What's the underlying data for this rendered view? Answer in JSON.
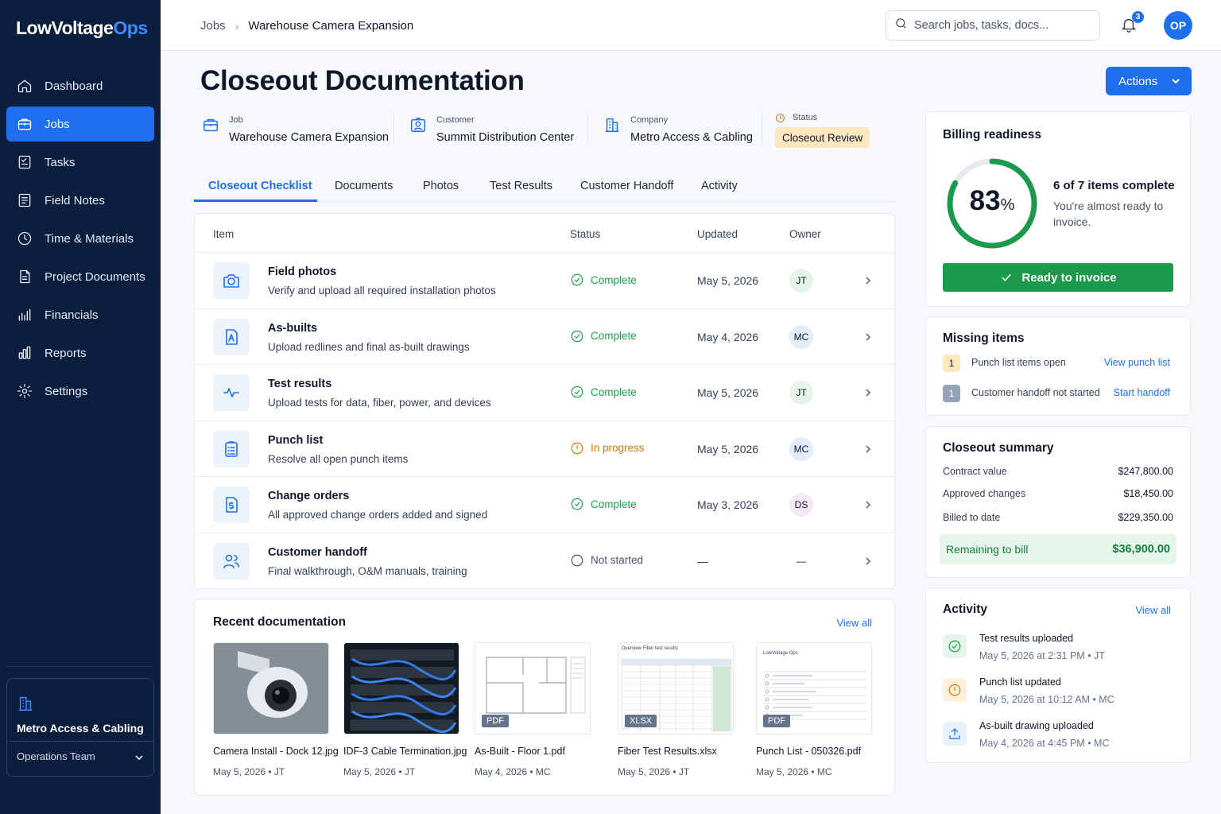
{
  "app": {
    "logo_main": "LowVoltage",
    "logo_accent": "Ops"
  },
  "sidebar": {
    "items": [
      {
        "label": "Dashboard",
        "icon": "home-icon"
      },
      {
        "label": "Jobs",
        "icon": "briefcase-icon",
        "active": true
      },
      {
        "label": "Tasks",
        "icon": "checklist-icon"
      },
      {
        "label": "Field Notes",
        "icon": "notes-icon"
      },
      {
        "label": "Time & Materials",
        "icon": "clock-icon"
      },
      {
        "label": "Project Documents",
        "icon": "document-icon"
      },
      {
        "label": "Financials",
        "icon": "financials-icon"
      },
      {
        "label": "Reports",
        "icon": "bar-chart-icon"
      },
      {
        "label": "Settings",
        "icon": "gear-icon"
      }
    ],
    "org": {
      "name": "Metro Access & Cabling",
      "team": "Operations Team"
    }
  },
  "topbar": {
    "breadcrumb": {
      "root": "Jobs",
      "current": "Warehouse Camera Expansion"
    },
    "search_placeholder": "Search jobs, tasks, docs...",
    "notifications_count": "3",
    "user_initials": "OP"
  },
  "header": {
    "title": "Closeout Documentation",
    "actions_label": "Actions",
    "meta": {
      "job_label": "Job",
      "job_value": "Warehouse Camera Expansion",
      "customer_label": "Customer",
      "customer_value": "Summit Distribution Center",
      "company_label": "Company",
      "company_value": "Metro Access & Cabling",
      "status_label": "Status",
      "status_value": "Closeout Review"
    }
  },
  "tabs": [
    "Closeout Checklist",
    "Documents",
    "Photos",
    "Test Results",
    "Customer Handoff",
    "Activity"
  ],
  "checklist": {
    "headers": {
      "item": "Item",
      "status": "Status",
      "updated": "Updated",
      "owner": "Owner"
    },
    "rows": [
      {
        "title": "Field photos",
        "desc": "Verify and upload all required installation photos",
        "status": "Complete",
        "state": "complete",
        "updated": "May 5, 2026",
        "owner": "JT",
        "icon": "camera-icon"
      },
      {
        "title": "As-builts",
        "desc": "Upload redlines and final as-built drawings",
        "status": "Complete",
        "state": "complete",
        "updated": "May 4, 2026",
        "owner": "MC",
        "icon": "drawing-icon"
      },
      {
        "title": "Test results",
        "desc": "Upload tests for data, fiber, power, and devices",
        "status": "Complete",
        "state": "complete",
        "updated": "May 5, 2026",
        "owner": "JT",
        "icon": "pulse-icon"
      },
      {
        "title": "Punch list",
        "desc": "Resolve all open punch items",
        "status": "In progress",
        "state": "progress",
        "updated": "May 5, 2026",
        "owner": "MC",
        "icon": "clipboard-icon"
      },
      {
        "title": "Change orders",
        "desc": "All approved change orders added and signed",
        "status": "Complete",
        "state": "complete",
        "updated": "May 3, 2026",
        "owner": "DS",
        "icon": "dollar-document-icon"
      },
      {
        "title": "Customer handoff",
        "desc": "Final walkthrough, O&M manuals, training",
        "status": "Not started",
        "state": "none",
        "updated": "—",
        "owner": "—",
        "icon": "users-icon"
      }
    ]
  },
  "recent": {
    "title": "Recent documentation",
    "view_all": "View all",
    "docs": [
      {
        "name": "Camera Install - Dock 12.jpg",
        "date": "May 5, 2026",
        "owner": "JT",
        "kind": "photo-camera"
      },
      {
        "name": "IDF-3 Cable Termination.jpg",
        "date": "May 5, 2026",
        "owner": "JT",
        "kind": "photo-rack"
      },
      {
        "name": "As-Built - Floor 1.pdf",
        "date": "May 4, 2026",
        "owner": "MC",
        "kind": "floorplan",
        "tag": "PDF"
      },
      {
        "name": "Fiber Test Results.xlsx",
        "date": "May 5, 2026",
        "owner": "JT",
        "kind": "sheet",
        "tag": "XLSX",
        "thumb_title": "Overview  Fiber test results"
      },
      {
        "name": "Punch List - 050326.pdf",
        "date": "May 5, 2026",
        "owner": "MC",
        "kind": "list",
        "tag": "PDF",
        "thumb_title": "LowVoltage Ops"
      }
    ]
  },
  "billing": {
    "title": "Billing readiness",
    "percent": 83,
    "percent_number": "83",
    "percent_symbol": "%",
    "count": "6 of 7 items complete",
    "sub": "You're almost ready to invoice.",
    "button": "Ready to invoice"
  },
  "missing": {
    "title": "Missing items",
    "items": [
      {
        "num": "1",
        "label": "Punch list items open",
        "link": "View punch list"
      },
      {
        "num": "1",
        "label": "Customer handoff not started",
        "link": "Start handoff"
      }
    ]
  },
  "summary": {
    "title": "Closeout summary",
    "rows": [
      {
        "label": "Contract value",
        "value": "$247,800.00"
      },
      {
        "label": "Approved changes",
        "value": "$18,450.00"
      },
      {
        "label": "Billed to date",
        "value": "$229,350.00"
      }
    ],
    "remaining_label": "Remaining to bill",
    "remaining_value": "$36,900.00"
  },
  "activity": {
    "title": "Activity",
    "view_all": "View all",
    "items": [
      {
        "title": "Test results uploaded",
        "meta": "May 5, 2026 at 2:31 PM  •  JT",
        "kind": "green"
      },
      {
        "title": "Punch list updated",
        "meta": "May 5, 2026 at 10:12 AM  •  MC",
        "kind": "amber"
      },
      {
        "title": "As-built drawing uploaded",
        "meta": "May 4, 2026 at 4:45 PM  •  MC",
        "kind": "blue"
      }
    ]
  },
  "colors": {
    "primary": "#1e6ff0",
    "sidebar": "#0c1e3d",
    "success": "#16a34a",
    "warning": "#d97706"
  }
}
